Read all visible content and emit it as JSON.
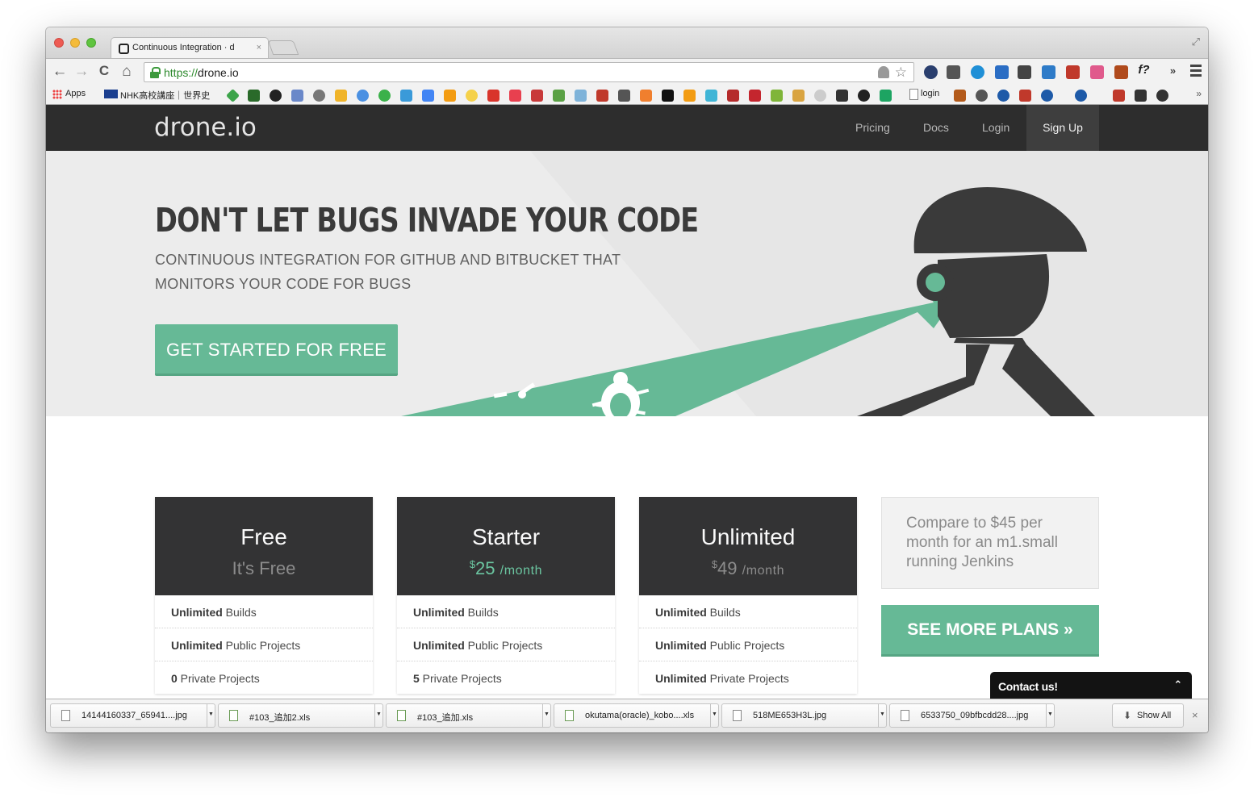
{
  "browser": {
    "tab_title": "Continuous Integration · d",
    "tab_close": "×",
    "url_scheme": "https://",
    "url_host": "drone.io",
    "nav": {
      "back": "←",
      "forward": "→",
      "reload": "C",
      "home": "⌂"
    },
    "star": "☆",
    "fullscreen": "⤢",
    "ext_f_label": "f?",
    "ext_overflow": "»"
  },
  "bookmarks": {
    "apps_label": "Apps",
    "nhk_label": "NHK高校講座｜世界史",
    "login_label": "login",
    "more": "»"
  },
  "site": {
    "logo": "drone.io",
    "nav_links": [
      "Pricing",
      "Docs",
      "Login"
    ],
    "nav_signup": "Sign Up",
    "hero": {
      "title": "DON'T LET BUGS INVADE YOUR CODE",
      "subtitle": "CONTINUOUS INTEGRATION FOR GITHUB AND BITBUCKET THAT MONITORS YOUR CODE FOR BUGS",
      "cta": "GET STARTED FOR FREE"
    },
    "plans": [
      {
        "name": "Free",
        "price_text": "It's Free",
        "rows": [
          {
            "strong": "Unlimited",
            "rest": " Builds"
          },
          {
            "strong": "Unlimited",
            "rest": " Public Projects"
          },
          {
            "strong": "0",
            "rest": " Private Projects"
          }
        ]
      },
      {
        "name": "Starter",
        "currency": "$",
        "amount": "25",
        "period": "/month",
        "rows": [
          {
            "strong": "Unlimited",
            "rest": " Builds"
          },
          {
            "strong": "Unlimited",
            "rest": " Public Projects"
          },
          {
            "strong": "5",
            "rest": " Private Projects"
          }
        ]
      },
      {
        "name": "Unlimited",
        "currency": "$",
        "amount": "49",
        "period": "/month",
        "rows": [
          {
            "strong": "Unlimited",
            "rest": " Builds"
          },
          {
            "strong": "Unlimited",
            "rest": " Public Projects"
          },
          {
            "strong": "Unlimited",
            "rest": " Private Projects"
          }
        ]
      }
    ],
    "compare_text": "Compare to $45 per month for an m1.small running Jenkins",
    "more_plans": "SEE MORE PLANS »",
    "contact": "Contact us!",
    "contact_chevron": "⌃"
  },
  "downloads": {
    "items": [
      {
        "name": "14144160337_65941....jpg",
        "kind": "image"
      },
      {
        "name": "#103_追加2.xls",
        "kind": "sheet"
      },
      {
        "name": "#103_追加.xls",
        "kind": "sheet"
      },
      {
        "name": "okutama(oracle)_kobo....xls",
        "kind": "sheet"
      },
      {
        "name": "518ME653H3L.jpg",
        "kind": "image"
      },
      {
        "name": "6533750_09bfbcdd28....jpg",
        "kind": "image"
      }
    ],
    "caret": "▼",
    "show_all": "Show All",
    "show_all_arrow": "⬇",
    "close": "×"
  },
  "colors": {
    "accent": "#66b996",
    "accent_text": "#6bc5a0",
    "nav_bg": "#2d2d2d",
    "plan_head": "#333334",
    "hero_bg": "#ececec",
    "robot": "#3a3a3a"
  }
}
